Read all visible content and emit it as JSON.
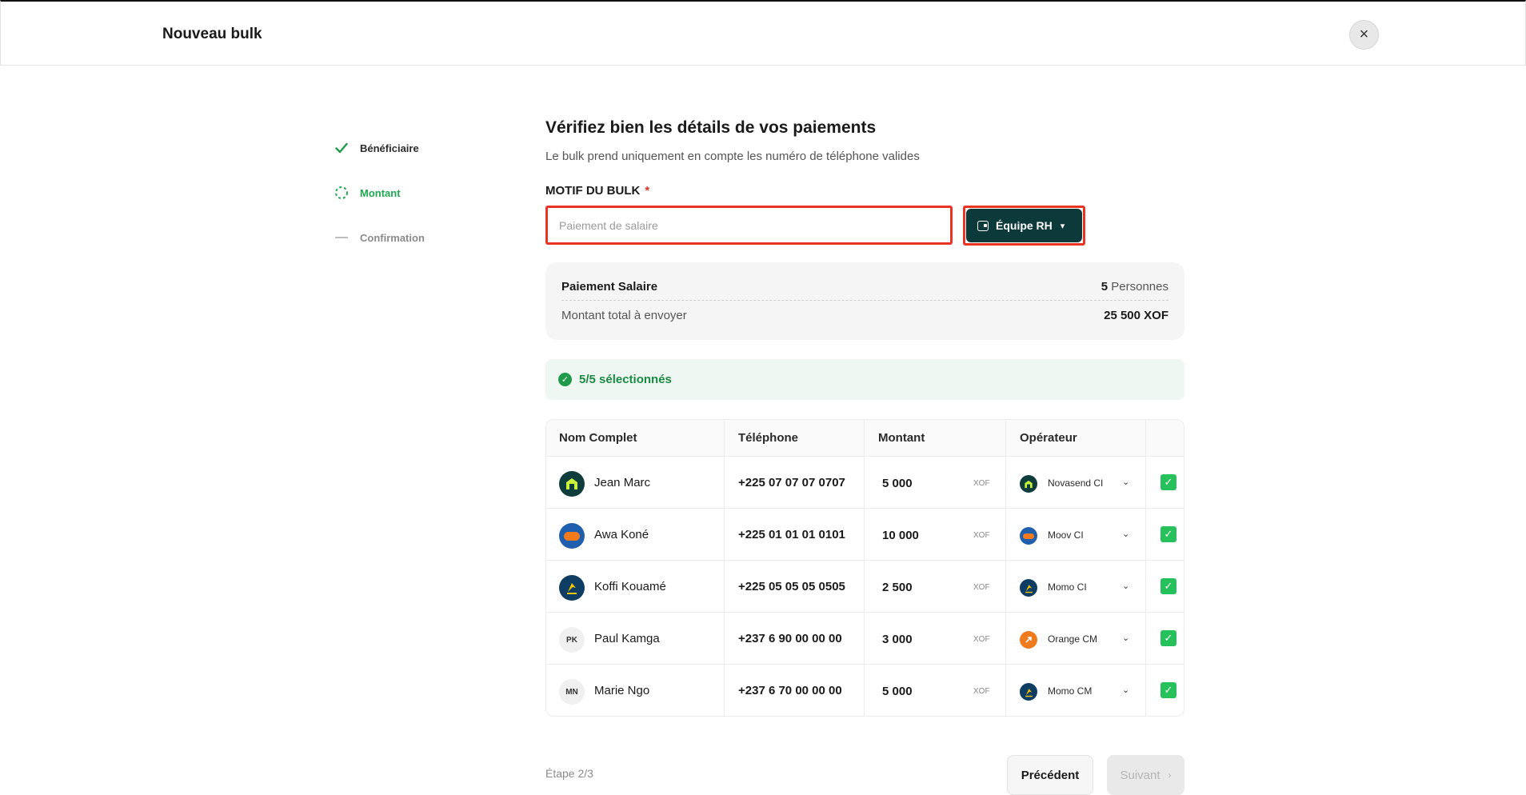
{
  "header": {
    "title": "Nouveau bulk",
    "close_icon": "×"
  },
  "stepper": [
    {
      "label": "Bénéficiaire",
      "state": "done"
    },
    {
      "label": "Montant",
      "state": "current"
    },
    {
      "label": "Confirmation",
      "state": "pending"
    }
  ],
  "main": {
    "title": "Vérifiez bien les détails de vos paiements",
    "subtitle": "Le bulk prend uniquement en compte les numéro de téléphone valides",
    "motif_label": "MOTIF DU BULK",
    "required_mark": "*",
    "motif_placeholder": "Paiement de salaire",
    "team_button": "Équipe RH"
  },
  "summary": {
    "label": "Paiement Salaire",
    "count": "5",
    "count_unit": "Personnes",
    "total_label": "Montant total à envoyer",
    "total_value": "25 500 XOF"
  },
  "selection": {
    "text": "5/5 sélectionnés"
  },
  "table": {
    "headers": [
      "Nom Complet",
      "Téléphone",
      "Montant",
      "Opérateur"
    ],
    "rows": [
      {
        "name": "Jean Marc",
        "phone": "+225 07 07 07 0707",
        "amount": "5 000",
        "currency": "XOF",
        "operator": "Novasend CI",
        "checked": true
      },
      {
        "name": "Awa Koné",
        "phone": "+225 01 01 01 0101",
        "amount": "10 000",
        "currency": "XOF",
        "operator": "Moov CI",
        "checked": true
      },
      {
        "name": "Koffi Kouamé",
        "phone": "+225 05 05 05 0505",
        "amount": "2 500",
        "currency": "XOF",
        "operator": "Momo CI",
        "checked": true
      },
      {
        "name": "Paul Kamga",
        "initials": "PK",
        "phone": "+237 6 90 00 00 00",
        "amount": "3 000",
        "currency": "XOF",
        "operator": "Orange CM",
        "checked": true
      },
      {
        "name": "Marie Ngo",
        "initials": "MN",
        "phone": "+237 6 70 00 00 00",
        "amount": "5 000",
        "currency": "XOF",
        "operator": "Momo CM",
        "checked": true
      }
    ]
  },
  "footer": {
    "step_text": "Étape 2/3",
    "prev_label": "Précédent",
    "next_label": "Suivant"
  },
  "colors": {
    "accent_green": "#1fa84f",
    "dark_teal": "#0c3a3a",
    "highlight_red": "#e93323",
    "checkbox_green": "#27c15b"
  }
}
